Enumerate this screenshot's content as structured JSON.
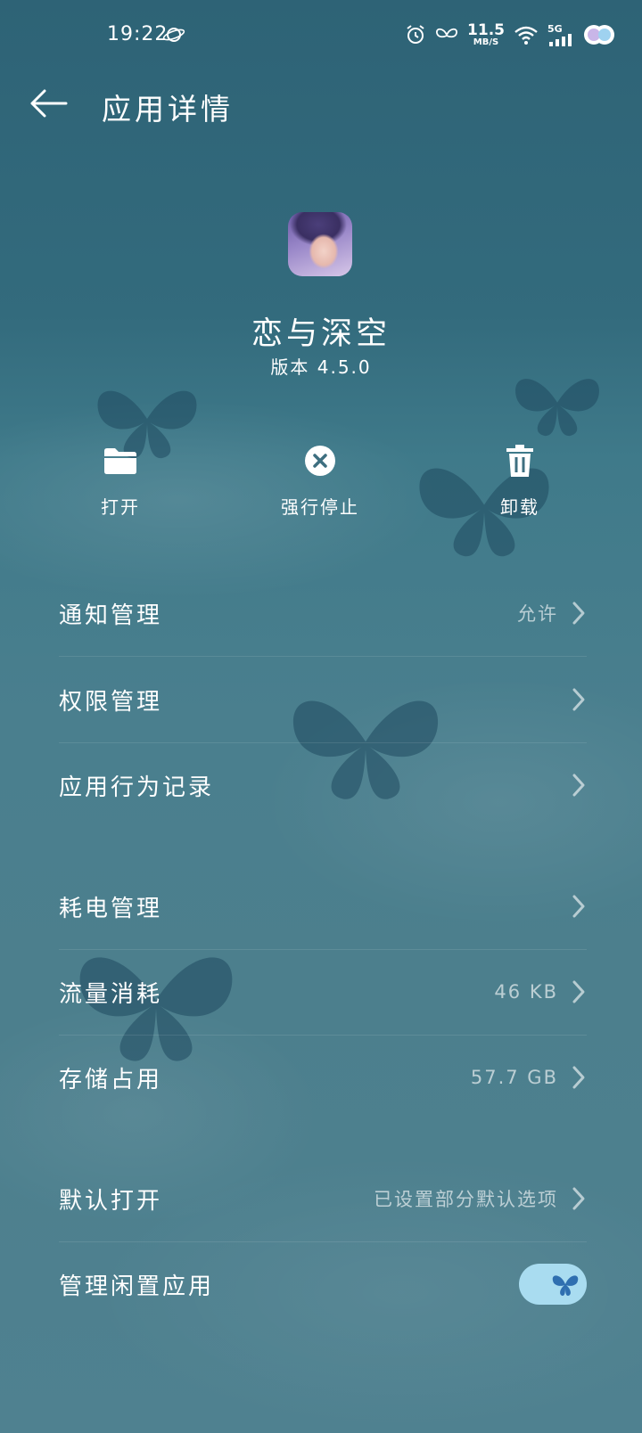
{
  "status_bar": {
    "time": "19:22",
    "net_speed_value": "11.5",
    "net_speed_unit": "MB/S",
    "network_type": "5G",
    "icons": [
      "planet-icon",
      "alarm-icon",
      "butterfly-status-icon",
      "wifi-icon",
      "signal-icon",
      "theme-badge-icon"
    ]
  },
  "header": {
    "title": "应用详情",
    "back_icon": "back-arrow-icon"
  },
  "app": {
    "name": "恋与深空",
    "version": "版本 4.5.0"
  },
  "actions": [
    {
      "label": "打开",
      "icon": "folder-icon"
    },
    {
      "label": "强行停止",
      "icon": "stop-icon"
    },
    {
      "label": "卸载",
      "icon": "trash-icon"
    }
  ],
  "settings": [
    {
      "label": "通知管理",
      "value": "允许"
    },
    {
      "label": "权限管理",
      "value": ""
    },
    {
      "label": "应用行为记录",
      "value": ""
    },
    {
      "label": "耗电管理",
      "value": ""
    },
    {
      "label": "流量消耗",
      "value": "46 KB"
    },
    {
      "label": "存储占用",
      "value": "57.7 GB"
    },
    {
      "label": "默认打开",
      "value": "已设置部分默认选项"
    },
    {
      "label": "管理闲置应用",
      "toggle_on": true
    }
  ],
  "colors": {
    "background_top": "#2e6376",
    "background_bottom": "#4f8190",
    "toggle_track": "#a9dcf0",
    "butterfly": "#1f4a60"
  }
}
